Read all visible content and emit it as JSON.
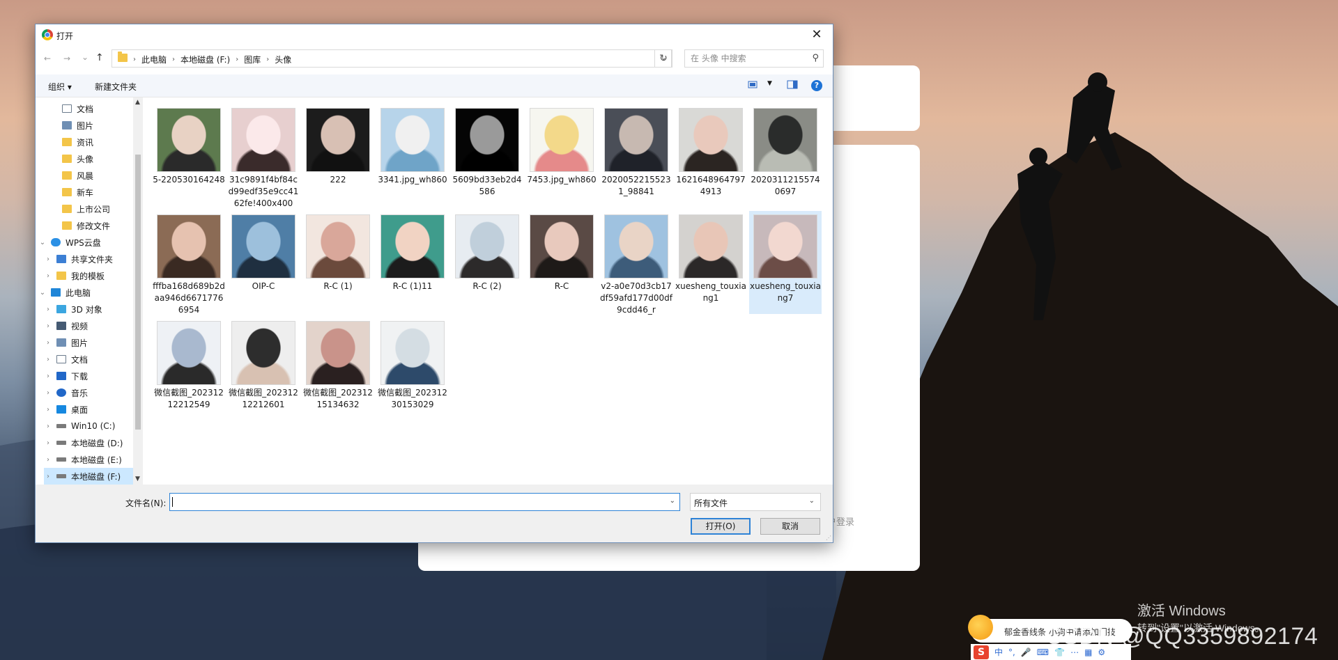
{
  "dialog": {
    "title": "打开",
    "close_glyph": "✕",
    "nav": {
      "back": "←",
      "forward": "→",
      "recent": "⌄",
      "up": "↑",
      "refresh": "↻"
    },
    "breadcrumb": [
      "此电脑",
      "本地磁盘 (F:)",
      "图库",
      "头像"
    ],
    "search_placeholder": "在 头像 中搜索",
    "toolbar": {
      "organize": "组织 ▾",
      "new_folder": "新建文件夹",
      "help": "?"
    },
    "sidebar": [
      {
        "label": "文档",
        "icon": "document-icon",
        "pinned": true
      },
      {
        "label": "图片",
        "icon": "pictures-icon",
        "pinned": true
      },
      {
        "label": "资讯",
        "icon": "folder-icon",
        "pinned": true
      },
      {
        "label": "头像",
        "icon": "folder-icon",
        "pinned": true
      },
      {
        "label": "风晨",
        "icon": "folder-icon",
        "pinned": false
      },
      {
        "label": "新车",
        "icon": "folder-icon",
        "pinned": false
      },
      {
        "label": "上市公司",
        "icon": "folder-icon",
        "pinned": false
      },
      {
        "label": "修改文件",
        "icon": "folder-icon",
        "pinned": false
      },
      {
        "label": "WPS云盘",
        "icon": "cloud-icon",
        "expanded": true
      },
      {
        "label": "共享文件夹",
        "icon": "share-icon"
      },
      {
        "label": "我的模板",
        "icon": "folder-icon"
      },
      {
        "label": "此电脑",
        "icon": "computer-icon",
        "expanded": true
      },
      {
        "label": "3D 对象",
        "icon": "3d-objects-icon"
      },
      {
        "label": "视频",
        "icon": "video-icon"
      },
      {
        "label": "图片",
        "icon": "pictures-icon"
      },
      {
        "label": "文档",
        "icon": "document-icon"
      },
      {
        "label": "下载",
        "icon": "download-icon"
      },
      {
        "label": "音乐",
        "icon": "music-icon"
      },
      {
        "label": "桌面",
        "icon": "desktop-icon"
      },
      {
        "label": "Win10 (C:)",
        "icon": "drive-icon"
      },
      {
        "label": "本地磁盘 (D:)",
        "icon": "drive-icon"
      },
      {
        "label": "本地磁盘 (E:)",
        "icon": "drive-icon"
      },
      {
        "label": "本地磁盘 (F:)",
        "icon": "drive-icon"
      }
    ],
    "files": [
      {
        "name": "5-220530164248",
        "colors": [
          "#5d7a4e",
          "#e8d2c4",
          "#2a2a2a"
        ]
      },
      {
        "name": "31c9891f4bf84cd99edf35e9cc4162fe!400x400",
        "colors": [
          "#e7cfcf",
          "#fbe9ea",
          "#3a2b2b"
        ]
      },
      {
        "name": "222",
        "colors": [
          "#1c1c1c",
          "#d8c0b4",
          "#111111"
        ]
      },
      {
        "name": "3341.jpg_wh860",
        "colors": [
          "#b7d4ea",
          "#f0f0f0",
          "#6fa4c8"
        ]
      },
      {
        "name": "5609bd33eb2d4586",
        "colors": [
          "#050505",
          "#9a9a9a",
          "#000000"
        ]
      },
      {
        "name": "7453.jpg_wh860",
        "colors": [
          "#f6f6f0",
          "#f3d98a",
          "#e58a8a"
        ]
      },
      {
        "name": "20200522155231_98841",
        "colors": [
          "#4a4e57",
          "#c7b9b1",
          "#1f2229"
        ]
      },
      {
        "name": "16216489647974913",
        "colors": [
          "#d9d9d6",
          "#e9c9bc",
          "#2b2522"
        ]
      },
      {
        "name": "20203112155740697",
        "colors": [
          "#8a8c86",
          "#2a2c2b",
          "#b9bcb4"
        ]
      },
      {
        "name": "fffba168d689b2daa946d66717766954",
        "colors": [
          "#8b6b55",
          "#e6c2b0",
          "#3a2a22"
        ]
      },
      {
        "name": "OIP-C",
        "colors": [
          "#4f7ea6",
          "#9dc0dc",
          "#1f2f40"
        ]
      },
      {
        "name": "R-C (1)",
        "colors": [
          "#f2e6df",
          "#d9a79a",
          "#6b4a3c"
        ]
      },
      {
        "name": "R-C (1)11",
        "colors": [
          "#3f9c8c",
          "#f1d3c3",
          "#1c1c1c"
        ]
      },
      {
        "name": "R-C (2)",
        "colors": [
          "#e7ecf1",
          "#c0cfdb",
          "#2c2a2a"
        ]
      },
      {
        "name": "R-C",
        "colors": [
          "#5a4a45",
          "#e8c9bd",
          "#1e1a18"
        ]
      },
      {
        "name": "v2-a0e70d3cb17df59afd177d00df9cdd46_r",
        "colors": [
          "#9fc2e0",
          "#e9d4c6",
          "#3d5c7a"
        ]
      },
      {
        "name": "xuesheng_touxiang1",
        "colors": [
          "#d4d2cf",
          "#e8c6b7",
          "#2b2828"
        ]
      },
      {
        "name": "xuesheng_touxiang7",
        "colors": [
          "#c7b9bb",
          "#f2d8d0",
          "#6c4d47"
        ]
      },
      {
        "name": "微信截图_20231212212549",
        "colors": [
          "#eef1f5",
          "#a9b9cf",
          "#2a2a2a"
        ]
      },
      {
        "name": "微信截图_20231212212601",
        "colors": [
          "#eeeeee",
          "#2d2d2d",
          "#d8c1b2"
        ]
      },
      {
        "name": "微信截图_20231215134632",
        "colors": [
          "#e3d3cb",
          "#c9938a",
          "#2a2020"
        ]
      },
      {
        "name": "微信截图_20231230153029",
        "colors": [
          "#f0f2f3",
          "#d4dde3",
          "#2d4a6a"
        ]
      }
    ],
    "filename_label": "文件名(N):",
    "filename_value": "",
    "filetype": "所有文件",
    "open_button": "打开(O)",
    "cancel_button": "取消"
  },
  "background": {
    "login_hint": "户登录",
    "activate_title": "激活 Windows",
    "activate_sub": "转到\"设置\"以激活 Windows。",
    "watermark": "CSDN @QQ3359892174",
    "ime_tip": "郁金香线条 小狗中请添加门技",
    "ime_bar": [
      "中",
      "°,",
      "🎤",
      "⌨",
      "👕",
      "⋯",
      "▦",
      "⚙"
    ]
  }
}
